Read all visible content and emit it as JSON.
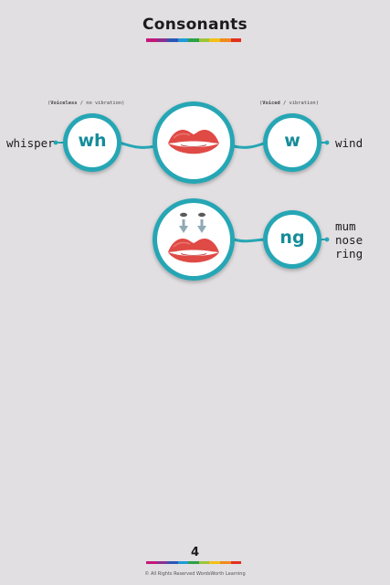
{
  "page": {
    "title": "Consonants",
    "page_number": "4",
    "copyright": "© All Rights Reserved WordsWorth Learning"
  },
  "rainbow_colors": [
    "#c2187b",
    "#8e2f8f",
    "#2f56b5",
    "#1f9ad6",
    "#2ca14a",
    "#9cc63a",
    "#f2c019",
    "#f18a1c",
    "#e2301f"
  ],
  "row1": {
    "note_left_bold": "Voiceless",
    "note_left_rest": " / no vibration",
    "note_right_bold": "Voiced",
    "note_right_rest": " / vibration",
    "left_sound": "wh",
    "right_sound": "w",
    "left_word": "whisper",
    "right_word": "wind"
  },
  "row2": {
    "sound": "ng",
    "words": [
      "mum",
      "nose",
      "ring"
    ]
  },
  "colors": {
    "teal": "#27a6b5",
    "lip_red": "#e04a45",
    "background": "#e1dfe1"
  },
  "icons": [
    "lips-icon",
    "lips-with-nose-icon",
    "down-arrows-icon"
  ]
}
